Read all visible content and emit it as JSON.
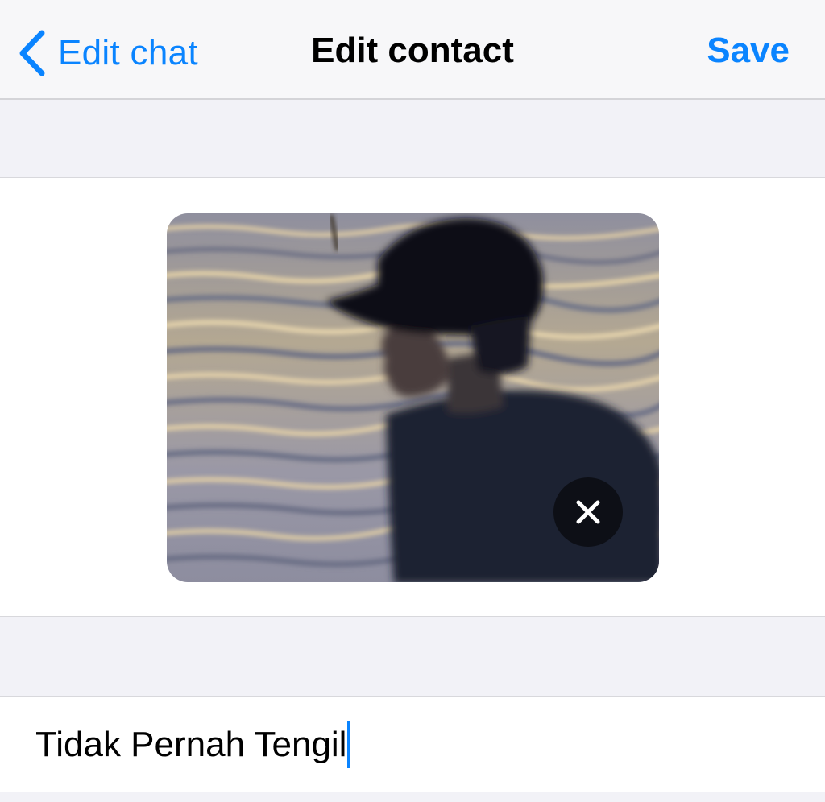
{
  "nav": {
    "back_label": "Edit chat",
    "title": "Edit contact",
    "save_label": "Save"
  },
  "contact": {
    "name_value": "Tidak Pernah Tengil"
  },
  "icons": {
    "back": "chevron-left-icon",
    "remove_photo": "close-icon"
  },
  "colors": {
    "accent": "#0a84ff",
    "background": "#f2f2f7",
    "panel": "#ffffff",
    "remove_button": "#0d0f16"
  }
}
